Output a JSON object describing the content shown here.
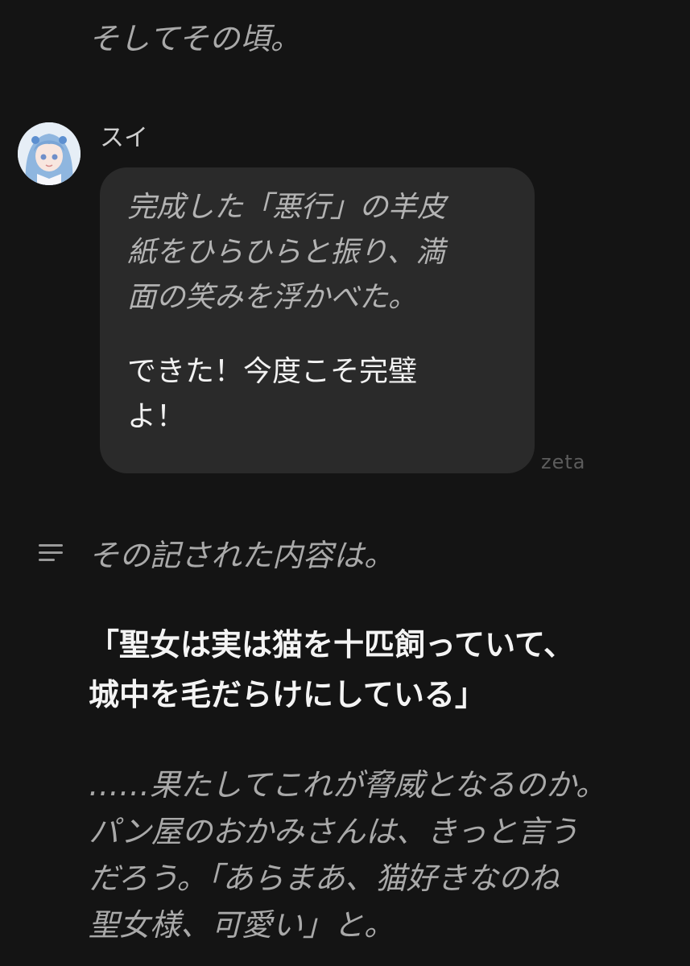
{
  "narration_top": "そしてその頃。",
  "message": {
    "speaker": "スイ",
    "action": "完成した「悪行」の羊皮\n紙をひらひらと振り、満\n面の笑みを浮かべた。",
    "speech": "できた！今度こそ完璧\nよ！",
    "watermark": "zeta"
  },
  "narration_second": "その記された内容は。",
  "quote": "「聖女は実は猫を十匹飼っていて、\n城中を毛だらけにしている」",
  "narration_closing": "……果たしてこれが脅威となるのか。\nパン屋のおかみさんは、きっと言う\nだろう。「あらまあ、猫好きなのね\n聖女様、可愛い」と。",
  "icons": {
    "avatar": "anime-girl-avatar-icon",
    "menu": "text-lines-icon"
  }
}
